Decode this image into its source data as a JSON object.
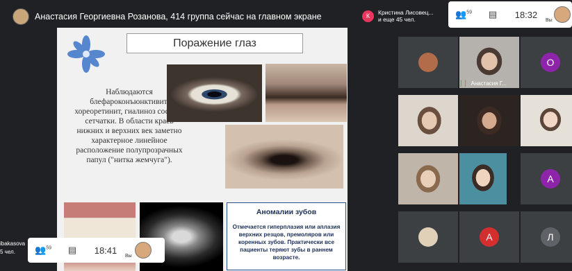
{
  "presentation": {
    "presenter_banner": "Анастасия Георгиевна Розанова, 414 группа сейчас на главном экране"
  },
  "slide": {
    "title": "Поражение глаз",
    "body": "Наблюдаются блефароконъюнктивит, хореоретинит, гиалиноз сосудов сетчатки. В области краев нижних и верхних век заметно характерное линейное расположение полупрозрачных папул (\"нитка жемчуга\").",
    "anomaly_heading": "Аномалии зубов",
    "anomaly_text": "Отмечается гиперплазия или аплазия верхних резцов, премоляров или коренных зубов. Практически все пациенты теряют зубы в раннем возрасте."
  },
  "notification": {
    "initial": "К",
    "line1": "Кристина Лисовец...",
    "line2": "и еще 45 чел."
  },
  "controls_top": {
    "participants_count": "59",
    "time": "18:32",
    "self_label": "Вы"
  },
  "controls_bottom": {
    "participants_count": "59",
    "time": "18:41",
    "self_label": "Вы"
  },
  "bottom_left_info": {
    "line1": "ibakasova",
    "line2": "5 чел."
  },
  "grid": {
    "tile_name_active": "Анастасия Г...",
    "letters": [
      "О",
      "А",
      "А",
      "Л"
    ],
    "letter_colors": [
      "#8e24aa",
      "#8e24aa",
      "#d32f2f",
      "#5f6368"
    ]
  },
  "colors": {
    "background": "#202124",
    "tile": "#3c4043",
    "notification_badge": "#e8365d"
  }
}
